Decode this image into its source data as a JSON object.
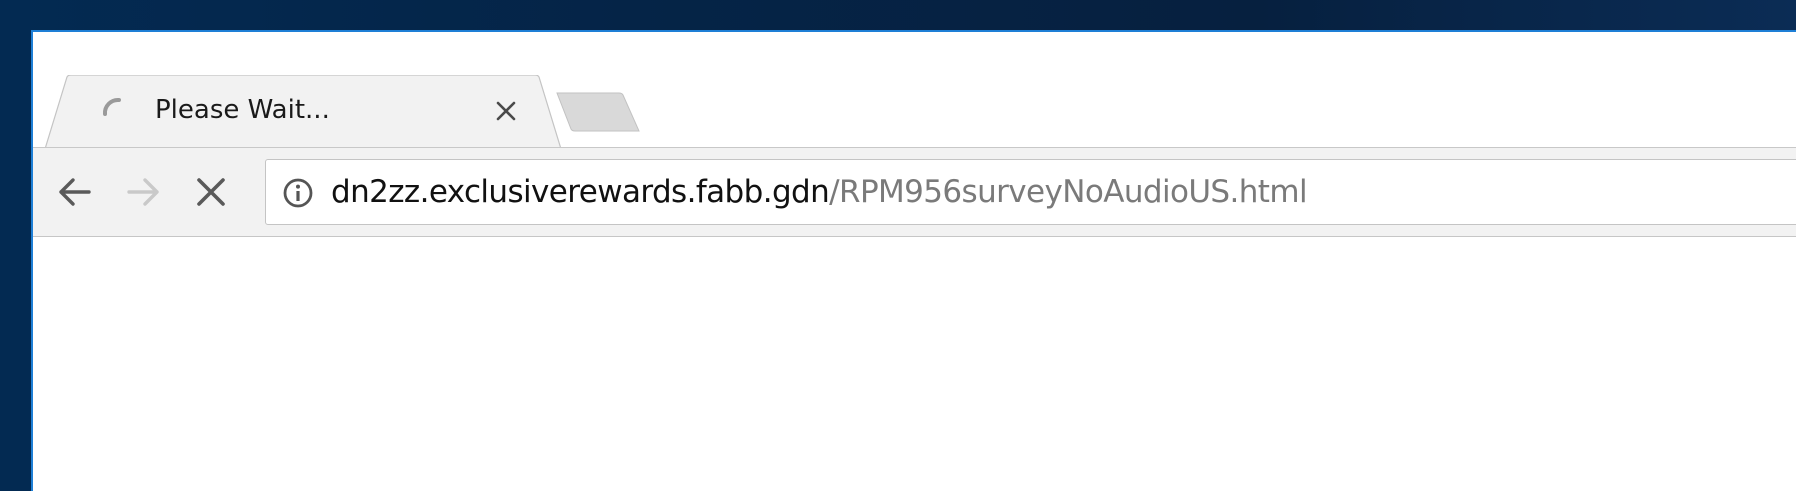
{
  "tab": {
    "title": "Please Wait...",
    "favicon": "loading-spinner-icon",
    "close_icon": "close-icon"
  },
  "new_tab": {
    "icon": "new-tab-icon"
  },
  "toolbar": {
    "back_icon": "back-arrow-icon",
    "forward_icon": "forward-arrow-icon",
    "stop_icon": "stop-icon",
    "forward_enabled": false
  },
  "omnibox": {
    "security_icon": "info-icon",
    "url_host": "dn2zz.exclusiverewards.fabb.gdn",
    "url_path": "/RPM956surveyNoAudioUS.html"
  },
  "colors": {
    "desktop_background": "#052447",
    "window_border": "#1e7fd6",
    "tab_active": "#f2f2f2",
    "url_host": "#111111",
    "url_path": "#7a7a7a"
  }
}
